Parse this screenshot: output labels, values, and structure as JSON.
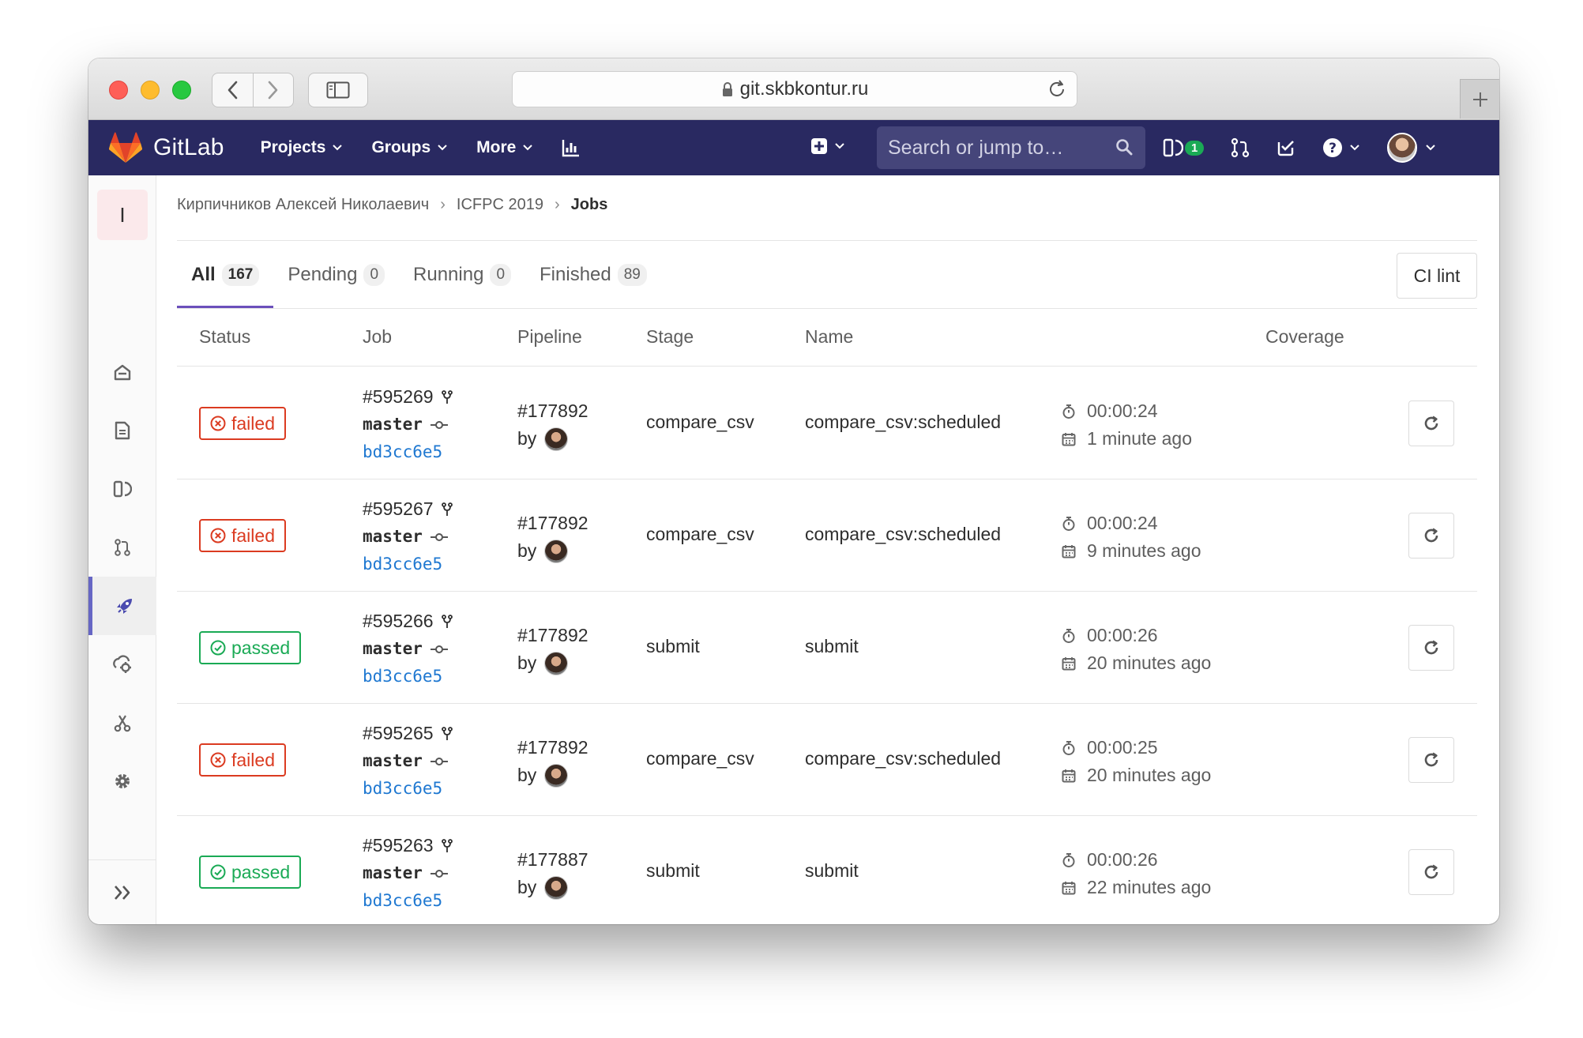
{
  "browser": {
    "url": "git.skbkontur.ru"
  },
  "header": {
    "brand": "GitLab",
    "nav": [
      {
        "label": "Projects"
      },
      {
        "label": "Groups"
      },
      {
        "label": "More"
      }
    ],
    "search_placeholder": "Search or jump to…",
    "issues_badge": "1",
    "colors": {
      "header_bg": "#292961",
      "accent": "#6b4fbb"
    }
  },
  "sidebar": {
    "project_letter": "I",
    "items": [
      {
        "icon": "home-icon"
      },
      {
        "icon": "document-icon"
      },
      {
        "icon": "issues-icon"
      },
      {
        "icon": "merge-request-icon"
      },
      {
        "icon": "rocket-icon",
        "active": true
      },
      {
        "icon": "operations-icon"
      },
      {
        "icon": "snippets-icon"
      },
      {
        "icon": "settings-icon"
      }
    ]
  },
  "breadcrumb": {
    "items": [
      "Кирпичников Алексей Николаевич",
      "ICFPC 2019"
    ],
    "current": "Jobs"
  },
  "tabs": [
    {
      "label": "All",
      "count": "167",
      "active": true
    },
    {
      "label": "Pending",
      "count": "0"
    },
    {
      "label": "Running",
      "count": "0"
    },
    {
      "label": "Finished",
      "count": "89"
    }
  ],
  "ci_lint_label": "CI lint",
  "table": {
    "columns": [
      "Status",
      "Job",
      "Pipeline",
      "Stage",
      "Name",
      "Coverage"
    ],
    "rows": [
      {
        "status": "failed",
        "job": "#595269",
        "branch": "master",
        "sha": "bd3cc6e5",
        "pipeline": "#177892",
        "by": "by",
        "stage": "compare_csv",
        "name": "compare_csv:scheduled",
        "duration": "00:00:24",
        "when": "1 minute ago"
      },
      {
        "status": "failed",
        "job": "#595267",
        "branch": "master",
        "sha": "bd3cc6e5",
        "pipeline": "#177892",
        "by": "by",
        "stage": "compare_csv",
        "name": "compare_csv:scheduled",
        "duration": "00:00:24",
        "when": "9 minutes ago"
      },
      {
        "status": "passed",
        "job": "#595266",
        "branch": "master",
        "sha": "bd3cc6e5",
        "pipeline": "#177892",
        "by": "by",
        "stage": "submit",
        "name": "submit",
        "duration": "00:00:26",
        "when": "20 minutes ago"
      },
      {
        "status": "failed",
        "job": "#595265",
        "branch": "master",
        "sha": "bd3cc6e5",
        "pipeline": "#177892",
        "by": "by",
        "stage": "compare_csv",
        "name": "compare_csv:scheduled",
        "duration": "00:00:25",
        "when": "20 minutes ago"
      },
      {
        "status": "passed",
        "job": "#595263",
        "branch": "master",
        "sha": "bd3cc6e5",
        "pipeline": "#177887",
        "by": "by",
        "stage": "submit",
        "name": "submit",
        "duration": "00:00:26",
        "when": "22 minutes ago"
      }
    ]
  },
  "status_colors": {
    "failed": "#db3b21",
    "passed": "#1aaa55"
  }
}
